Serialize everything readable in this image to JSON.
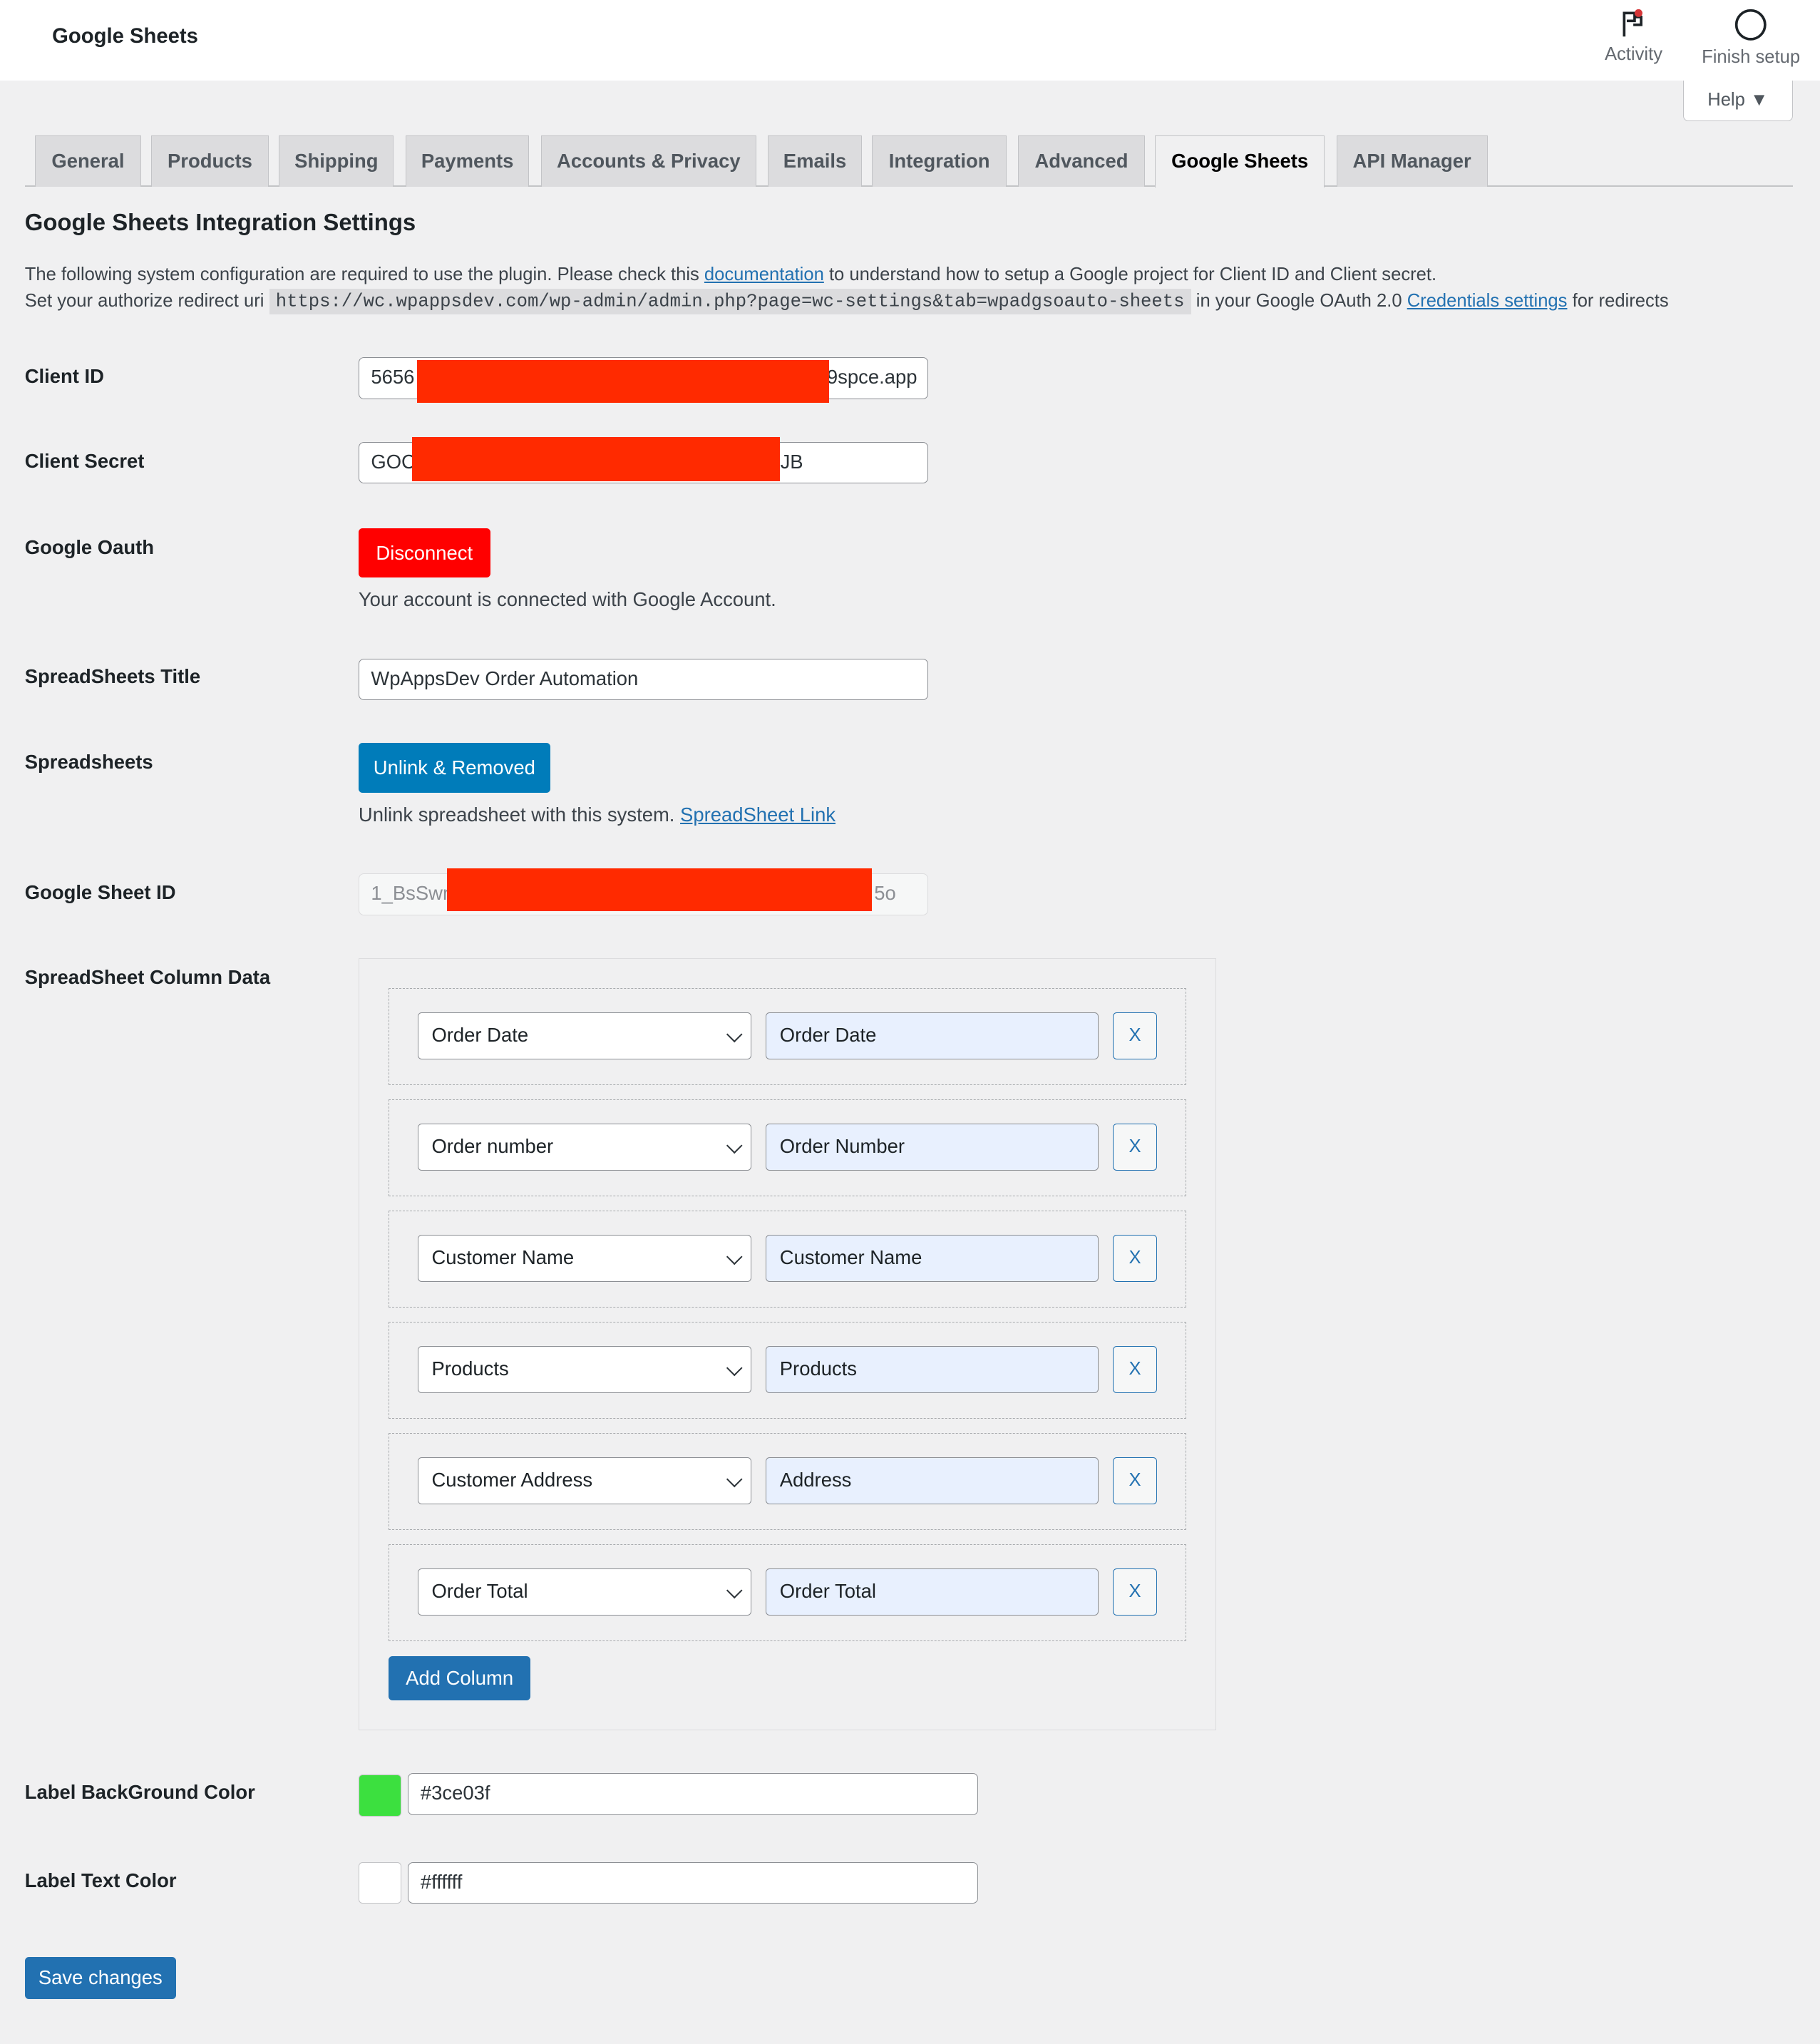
{
  "header": {
    "title": "Google Sheets",
    "activity_label": "Activity",
    "finish_setup_label": "Finish setup",
    "help_label": "Help ▼"
  },
  "tabs": [
    {
      "label": "General"
    },
    {
      "label": "Products"
    },
    {
      "label": "Shipping"
    },
    {
      "label": "Payments"
    },
    {
      "label": "Accounts & Privacy"
    },
    {
      "label": "Emails"
    },
    {
      "label": "Integration"
    },
    {
      "label": "Advanced"
    },
    {
      "label": "Google Sheets",
      "active": true
    },
    {
      "label": "API Manager"
    }
  ],
  "page": {
    "heading": "Google Sheets Integration Settings",
    "intro1_a": "The following system configuration are required to use the plugin. Please check this ",
    "intro1_link": "documentation",
    "intro1_b": " to understand how to setup a Google project for Client ID and Client secret.",
    "intro2_a": "Set your authorize redirect uri ",
    "redirect_uri": "https://wc.wpappsdev.com/wp-admin/admin.php?page=wc-settings&tab=wpadgsoauto-sheets",
    "intro2_b": " in your Google OAuth 2.0 ",
    "intro2_link": "Credentials settings",
    "intro2_c": " for redirects"
  },
  "fields": {
    "client_id": {
      "label": "Client ID",
      "value_start": "5656",
      "value_end": "9spce.app"
    },
    "client_secret": {
      "label": "Client Secret",
      "value_start": "GOC",
      "value_end": "JB"
    },
    "oauth": {
      "label": "Google Oauth",
      "button": "Disconnect",
      "status": "Your account is connected with Google Account."
    },
    "title": {
      "label": "SpreadSheets Title",
      "value": "WpAppsDev Order Automation"
    },
    "spreadsheets": {
      "label": "Spreadsheets",
      "button": "Unlink & Removed",
      "desc": "Unlink spreadsheet with this system. ",
      "link": "SpreadSheet Link"
    },
    "sheet_id": {
      "label": "Google Sheet ID",
      "value_start": "1_BsSwr",
      "value_end": "5o"
    },
    "columns": {
      "label": "SpreadSheet Column Data",
      "add_button": "Add Column",
      "remove_label": "X",
      "rows": [
        {
          "field": "Order Date",
          "title": "Order Date"
        },
        {
          "field": "Order number",
          "title": "Order Number"
        },
        {
          "field": "Customer Name",
          "title": "Customer Name"
        },
        {
          "field": "Products",
          "title": "Products"
        },
        {
          "field": "Customer Address",
          "title": "Address"
        },
        {
          "field": "Order Total",
          "title": "Order Total"
        }
      ]
    },
    "label_bg": {
      "label": "Label BackGround Color",
      "value": "#3ce03f"
    },
    "label_text": {
      "label": "Label Text Color",
      "value": "#ffffff"
    }
  },
  "save_label": "Save changes",
  "colors": {
    "disconnect": "#ff0000",
    "unlink": "#007cba",
    "primary": "#2271b1",
    "redaction": "#ff2a00"
  }
}
